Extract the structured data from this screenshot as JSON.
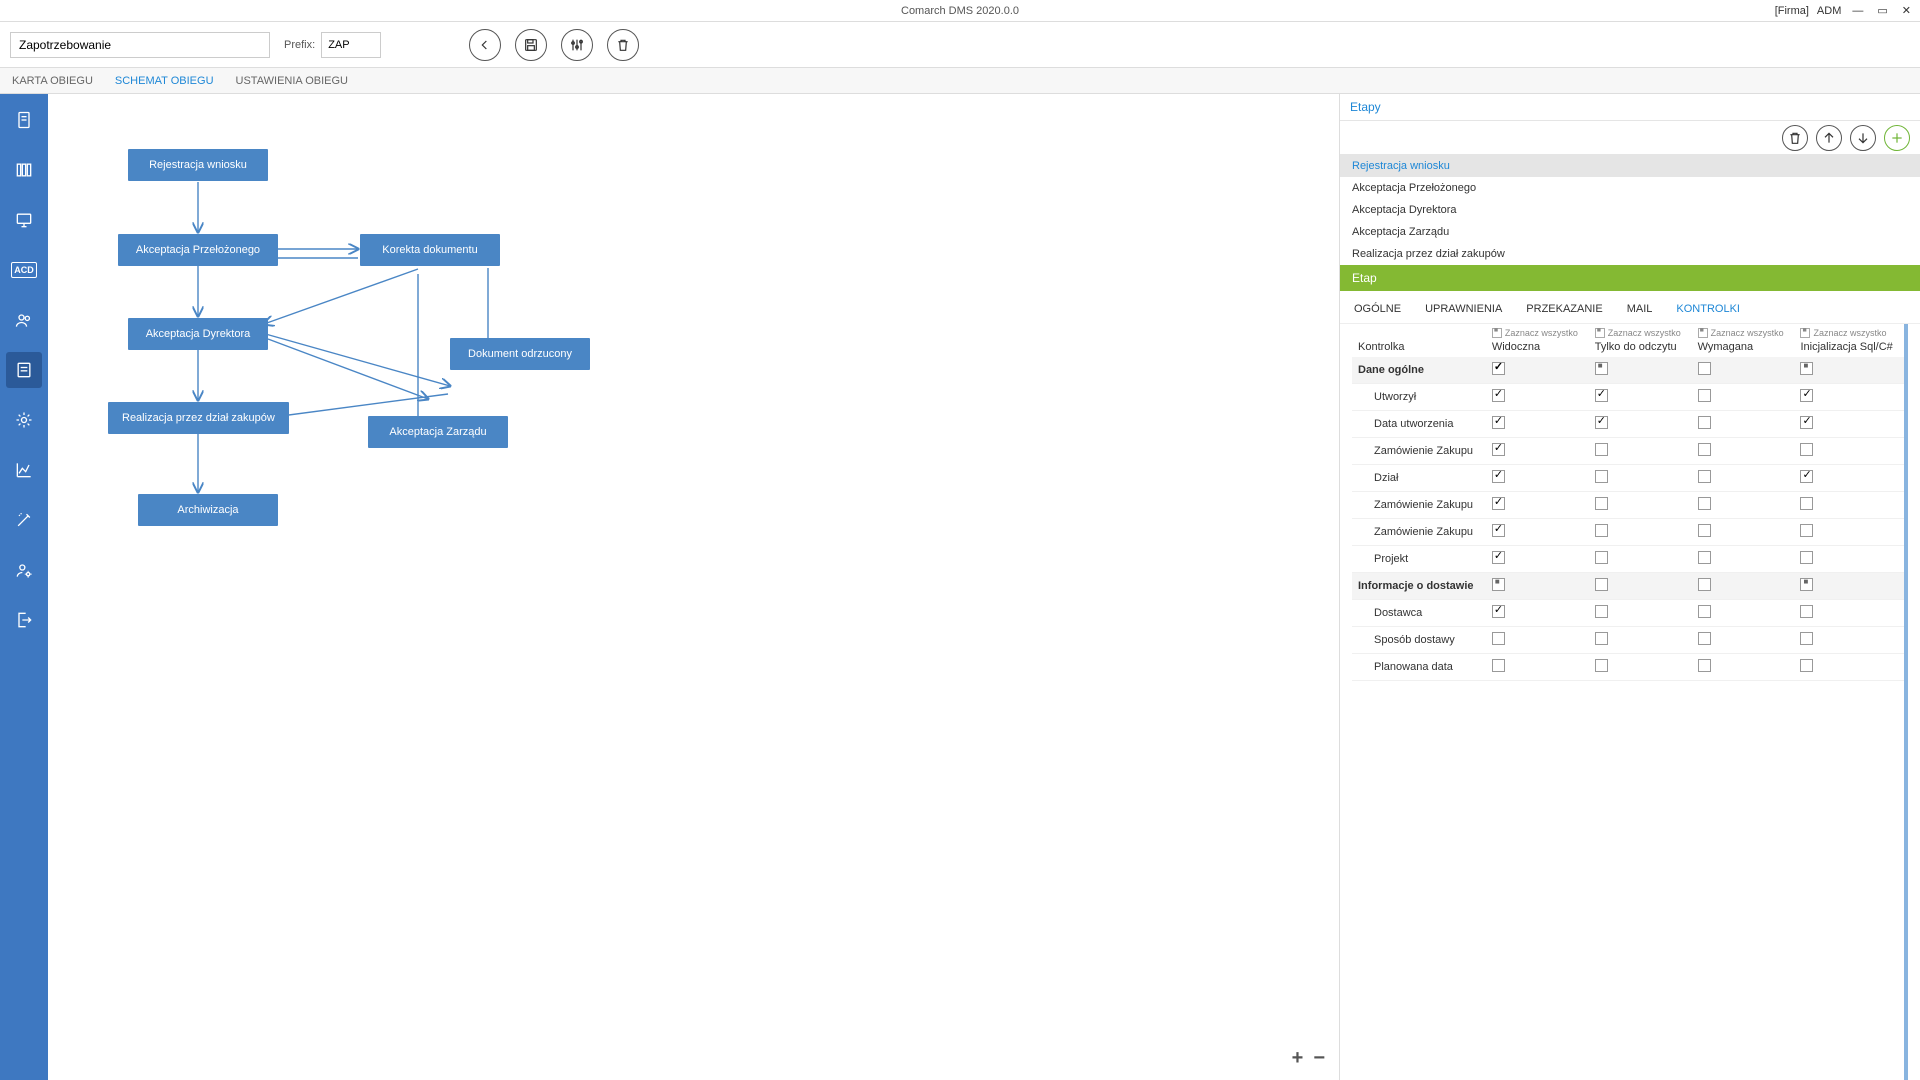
{
  "title": "Comarch DMS 2020.0.0",
  "user": {
    "firm": "[Firma]",
    "login": "ADM"
  },
  "toolbar": {
    "name_value": "Zapotrzebowanie",
    "prefix_label": "Prefix:",
    "prefix_value": "ZAP"
  },
  "tabs": {
    "card": "KARTA OBIEGU",
    "schema": "SCHEMAT OBIEGU",
    "settings": "USTAWIENIA OBIEGU",
    "active": "schema"
  },
  "workflow_nodes": {
    "n1": "Rejestracja wniosku",
    "n2": "Akceptacja Przełożonego",
    "n3": "Akceptacja Dyrektora",
    "n4": "Realizacja przez dział zakupów",
    "n5": "Archiwizacja",
    "n6": "Korekta dokumentu",
    "n7": "Dokument odrzucony",
    "n8": "Akceptacja Zarządu"
  },
  "right": {
    "etapy_title": "Etapy",
    "stages": [
      "Rejestracja wniosku",
      "Akceptacja Przełożonego",
      "Akceptacja Dyrektora",
      "Akceptacja Zarządu",
      "Realizacja przez dział zakupów"
    ],
    "selected_stage": 0,
    "etap_header": "Etap",
    "etap_tabs": {
      "ogolne": "OGÓLNE",
      "upraw": "UPRAWNIENIA",
      "przek": "PRZEKAZANIE",
      "mail": "MAIL",
      "kontrolki": "KONTROLKI",
      "active": "kontrolki"
    },
    "grid": {
      "col_kontrolka": "Kontrolka",
      "col_widoczna": "Widoczna",
      "col_odczyt": "Tylko do odczytu",
      "col_wymagana": "Wymagana",
      "col_init": "Inicjalizacja Sql/C#",
      "selall_text": "Zaznacz wszystko",
      "rows": [
        {
          "name": "Dane ogólne",
          "group": true,
          "v": "on",
          "ro": "ind",
          "req": "",
          "init": "ind"
        },
        {
          "name": "Utworzył",
          "v": "on",
          "ro": "on",
          "req": "",
          "init": "on"
        },
        {
          "name": "Data utworzenia",
          "v": "on",
          "ro": "on",
          "req": "",
          "init": "on"
        },
        {
          "name": "Zamówienie Zakupu",
          "v": "on",
          "ro": "",
          "req": "",
          "init": ""
        },
        {
          "name": "Dział",
          "v": "on",
          "ro": "",
          "req": "",
          "init": "on"
        },
        {
          "name": "Zamówienie Zakupu",
          "v": "on",
          "ro": "",
          "req": "",
          "init": ""
        },
        {
          "name": "Zamówienie Zakupu",
          "v": "on",
          "ro": "",
          "req": "",
          "init": ""
        },
        {
          "name": "Projekt",
          "v": "on",
          "ro": "",
          "req": "",
          "init": ""
        },
        {
          "name": "Informacje o dostawie",
          "group": true,
          "v": "ind",
          "ro": "",
          "req": "",
          "init": "ind"
        },
        {
          "name": "Dostawca",
          "v": "on",
          "ro": "",
          "req": "",
          "init": ""
        },
        {
          "name": "Sposób dostawy",
          "v": "",
          "ro": "",
          "req": "",
          "init": ""
        },
        {
          "name": "Planowana data",
          "v": "",
          "ro": "",
          "req": "",
          "init": ""
        }
      ]
    }
  }
}
